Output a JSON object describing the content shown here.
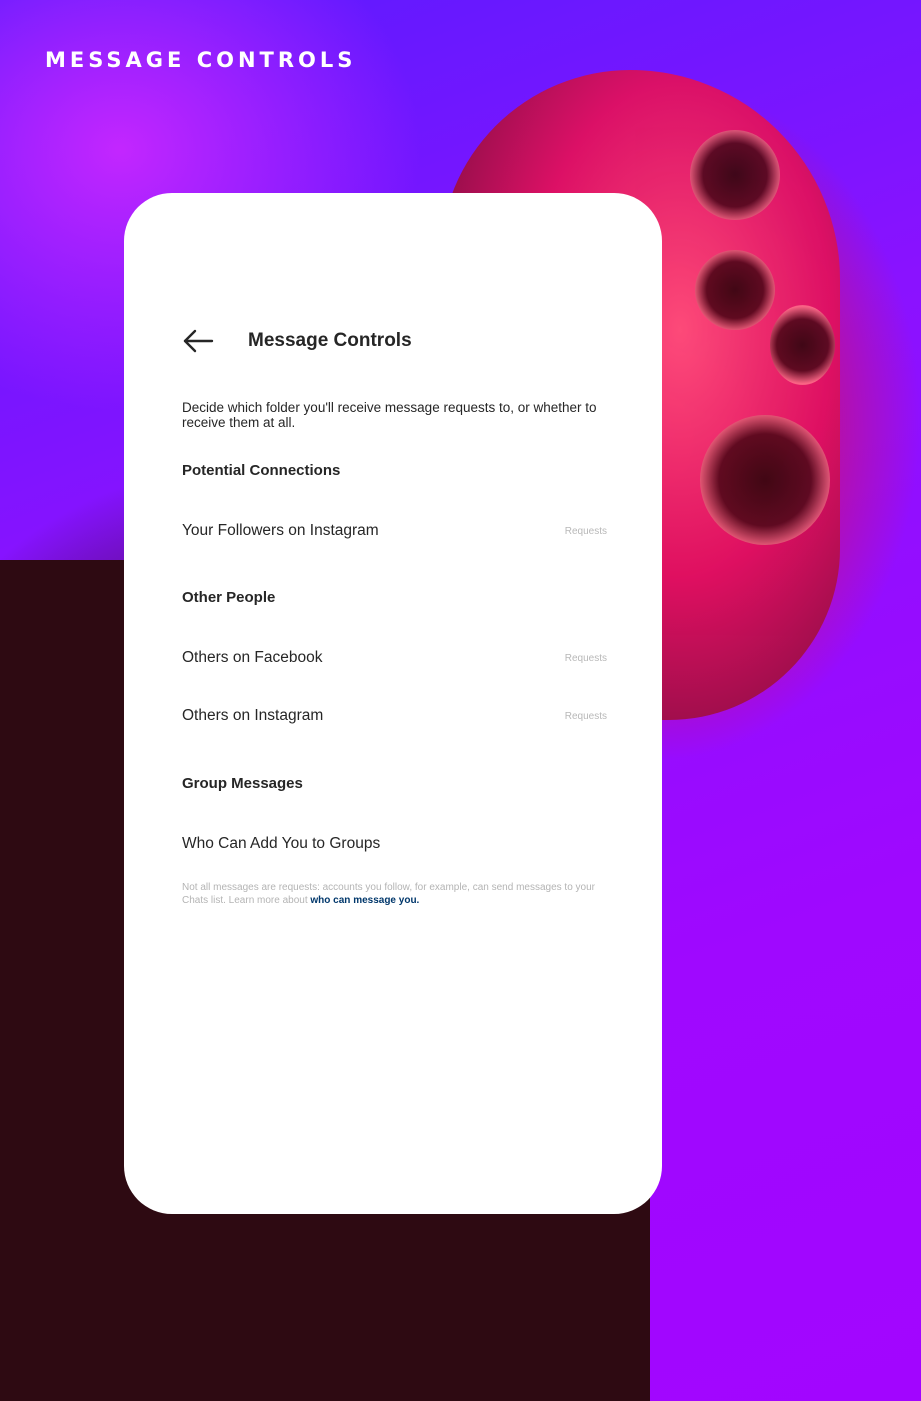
{
  "page_label": "MESSAGE CONTROLS",
  "screen": {
    "title": "Message Controls",
    "description": "Decide which folder you'll receive message requests to, or whether to receive them at all.",
    "sections": [
      {
        "heading": "Potential Connections",
        "rows": [
          {
            "label": "Your Followers on Instagram",
            "value": "Requests"
          }
        ]
      },
      {
        "heading": "Other People",
        "rows": [
          {
            "label": "Others on Facebook",
            "value": "Requests"
          },
          {
            "label": "Others on Instagram",
            "value": "Requests"
          }
        ]
      },
      {
        "heading": "Group Messages",
        "rows": [
          {
            "label": "Who Can Add You to Groups",
            "value": ""
          }
        ]
      }
    ],
    "footnote_text": "Not all messages are requests: accounts you follow, for example, can send messages to your Chats list. Learn more about ",
    "footnote_link": "who can message you."
  },
  "colors": {
    "background": "#8a12ff",
    "accent": "#ff2f86",
    "card": "#ffffff",
    "link": "#00376b"
  },
  "icons": {
    "back": "arrow-left-icon"
  }
}
